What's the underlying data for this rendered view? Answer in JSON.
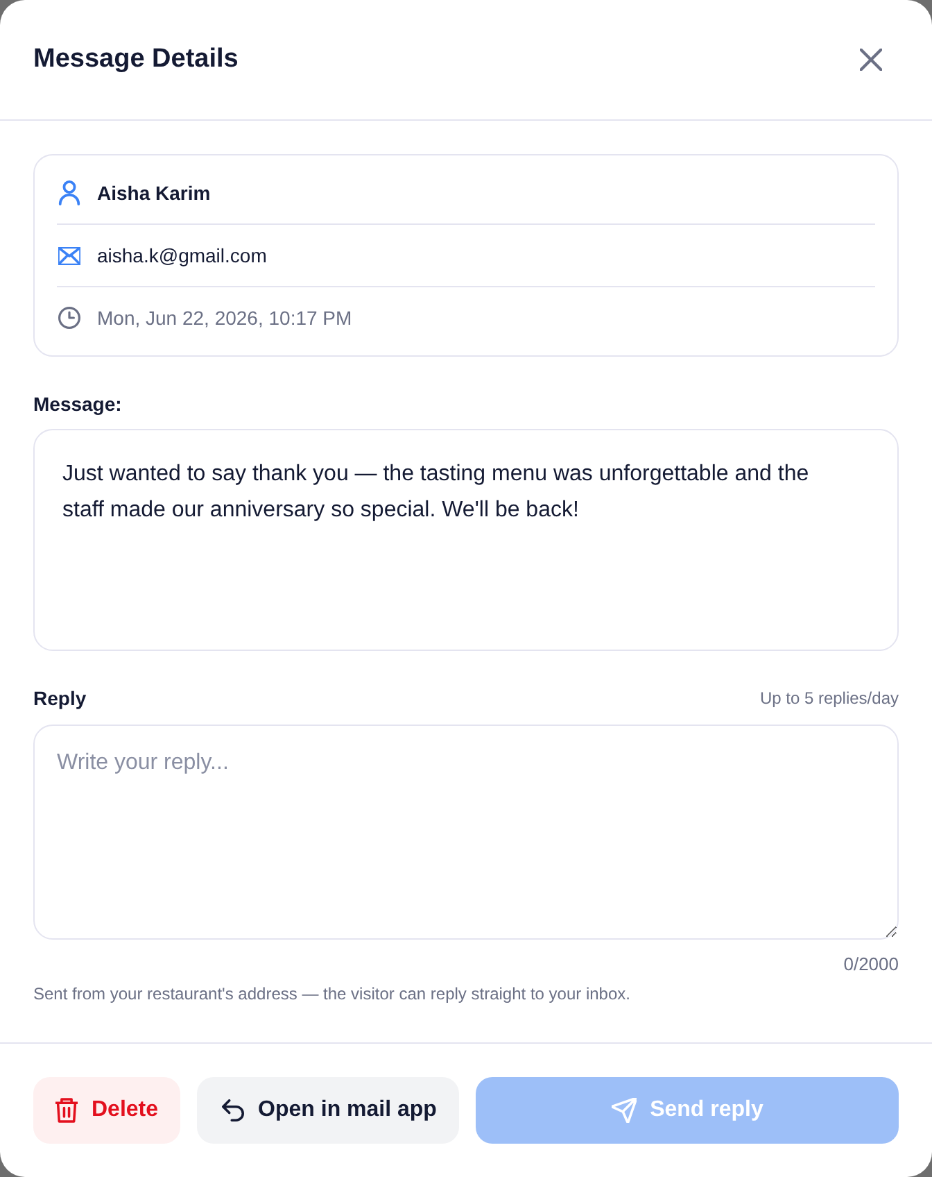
{
  "dialog": {
    "title": "Message Details"
  },
  "details": [
    {
      "kind": "name",
      "text": "Aisha Karim"
    },
    {
      "kind": "email",
      "text": "aisha.k@gmail.com"
    },
    {
      "kind": "time",
      "text": "Mon, Jun 22, 2026, 10:17 PM"
    }
  ],
  "message": {
    "label": "Message:",
    "text": "Just wanted to say thank you — the tasting menu was unforgettable and the staff made our anniversary so special. We'll be back!"
  },
  "reply": {
    "label": "Reply",
    "limit": "Up to 5 replies/day",
    "placeholder": "Write your reply...",
    "counter": "0/2000",
    "hint": "Sent from your restaurant's address — the visitor can reply straight to your inbox."
  },
  "actions": [
    {
      "kind": "delete",
      "label": "Delete",
      "disabled": false
    },
    {
      "kind": "open",
      "label": "Open in mail app",
      "disabled": false
    },
    {
      "kind": "send",
      "label": "Send reply",
      "disabled": true
    }
  ]
}
